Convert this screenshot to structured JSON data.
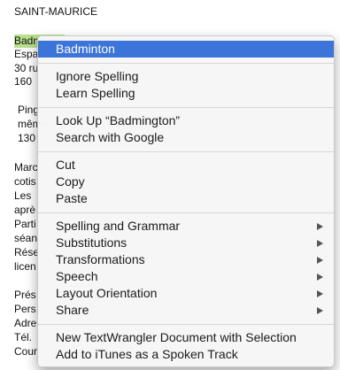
{
  "document": {
    "lines": [
      "SAINT-MAURICE",
      "Badminton",
      "Espa",
      "30 ru",
      "160",
      "Ping",
      "même",
      "130",
      "Marc",
      "cotis",
      "Les",
      "aprè",
      "Parti",
      "séan",
      "Rése",
      "licen",
      "Prés",
      "Pers",
      "Adre",
      "Tél.",
      "Cour"
    ]
  },
  "context_menu": {
    "groups": [
      [
        {
          "label": "Badminton",
          "selected": true,
          "submenu": false
        }
      ],
      [
        {
          "label": "Ignore Spelling",
          "selected": false,
          "submenu": false
        },
        {
          "label": "Learn Spelling",
          "selected": false,
          "submenu": false
        }
      ],
      [
        {
          "label": "Look Up “Badmington”",
          "selected": false,
          "submenu": false
        },
        {
          "label": "Search with Google",
          "selected": false,
          "submenu": false
        }
      ],
      [
        {
          "label": "Cut",
          "selected": false,
          "submenu": false
        },
        {
          "label": "Copy",
          "selected": false,
          "submenu": false
        },
        {
          "label": "Paste",
          "selected": false,
          "submenu": false
        }
      ],
      [
        {
          "label": "Spelling and Grammar",
          "selected": false,
          "submenu": true
        },
        {
          "label": "Substitutions",
          "selected": false,
          "submenu": true
        },
        {
          "label": "Transformations",
          "selected": false,
          "submenu": true
        },
        {
          "label": "Speech",
          "selected": false,
          "submenu": true
        },
        {
          "label": "Layout Orientation",
          "selected": false,
          "submenu": true
        },
        {
          "label": "Share",
          "selected": false,
          "submenu": true
        }
      ],
      [
        {
          "label": "New TextWrangler Document with Selection",
          "selected": false,
          "submenu": false
        },
        {
          "label": "Add to iTunes as a Spoken Track",
          "selected": false,
          "submenu": false
        }
      ]
    ]
  }
}
